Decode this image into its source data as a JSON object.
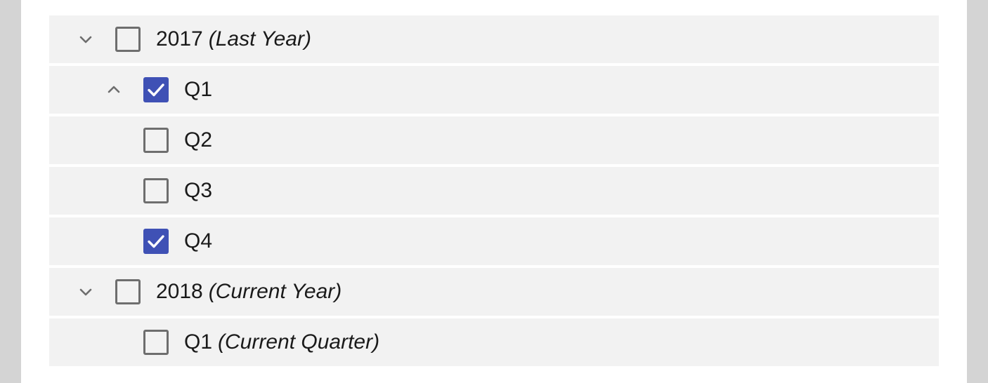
{
  "colors": {
    "checkbox_checked": "#3f51b5",
    "row_background": "#f2f2f2",
    "checkbox_border": "#6e6e6e"
  },
  "tree": {
    "rows": [
      {
        "label": "2017",
        "note": "(Last Year)",
        "level": 0,
        "chevron": "chevron-down",
        "checked": false
      },
      {
        "label": "Q1",
        "note": "",
        "level": 1,
        "chevron": "chevron-up",
        "checked": true
      },
      {
        "label": "Q2",
        "note": "",
        "level": 1,
        "chevron": "",
        "checked": false
      },
      {
        "label": "Q3",
        "note": "",
        "level": 1,
        "chevron": "",
        "checked": false
      },
      {
        "label": "Q4",
        "note": "",
        "level": 1,
        "chevron": "",
        "checked": true
      },
      {
        "label": "2018",
        "note": "(Current Year)",
        "level": 0,
        "chevron": "chevron-down",
        "checked": false
      },
      {
        "label": "Q1",
        "note": "(Current Quarter)",
        "level": 1,
        "chevron": "",
        "checked": false
      }
    ]
  }
}
